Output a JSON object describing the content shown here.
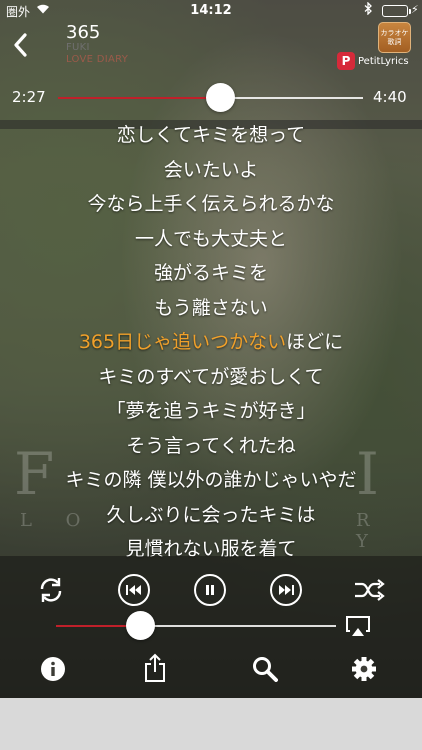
{
  "status": {
    "carrier": "圏外",
    "time": "14:12"
  },
  "song": {
    "title": "365",
    "artist": "FUKI",
    "album": "LOVE DIARY"
  },
  "karaoke_button": {
    "line1": "カラオケ",
    "line2": "歌詞"
  },
  "provider": {
    "logo_letter": "P",
    "name": "PetitLyrics"
  },
  "playback": {
    "elapsed": "2:27",
    "total": "4:40",
    "progress": 0.53
  },
  "background_art": {
    "left_letter": "F",
    "right_letter": "I",
    "left_sub": "L O",
    "right_sub": "R Y"
  },
  "lyrics": [
    {
      "pre": "恋しくてキミを想って",
      "hl": "",
      "post": ""
    },
    {
      "pre": "会いたいよ",
      "hl": "",
      "post": ""
    },
    {
      "pre": "今なら上手く伝えられるかな",
      "hl": "",
      "post": ""
    },
    {
      "pre": "一人でも大丈夫と",
      "hl": "",
      "post": ""
    },
    {
      "pre": "強がるキミを",
      "hl": "",
      "post": ""
    },
    {
      "pre": "もう離さない",
      "hl": "",
      "post": ""
    },
    {
      "pre": "",
      "hl": "365日じゃ追いつかない",
      "post": "ほどに"
    },
    {
      "pre": "キミのすべてが愛おしくて",
      "hl": "",
      "post": ""
    },
    {
      "pre": "「夢を追うキミが好き」",
      "hl": "",
      "post": ""
    },
    {
      "pre": "そう言ってくれたね",
      "hl": "",
      "post": ""
    },
    {
      "pre": "キミの隣 僕以外の誰かじゃいやだ",
      "hl": "",
      "post": ""
    },
    {
      "pre": "久しぶりに会ったキミは",
      "hl": "",
      "post": ""
    },
    {
      "pre": "見慣れない服を着て",
      "hl": "",
      "post": ""
    }
  ],
  "volume": {
    "level": 0.3
  },
  "colors": {
    "accent_red": "#c0202a",
    "highlight_orange": "#f0a02a",
    "karaoke_orange": "#b86e2e",
    "petit_red": "#d62a3a"
  },
  "icons": {
    "controls": [
      "repeat-icon",
      "previous-icon",
      "pause-icon",
      "next-icon",
      "shuffle-icon",
      "airplay-icon"
    ],
    "toolbar": [
      "info-icon",
      "share-icon",
      "search-icon",
      "gear-icon"
    ]
  }
}
